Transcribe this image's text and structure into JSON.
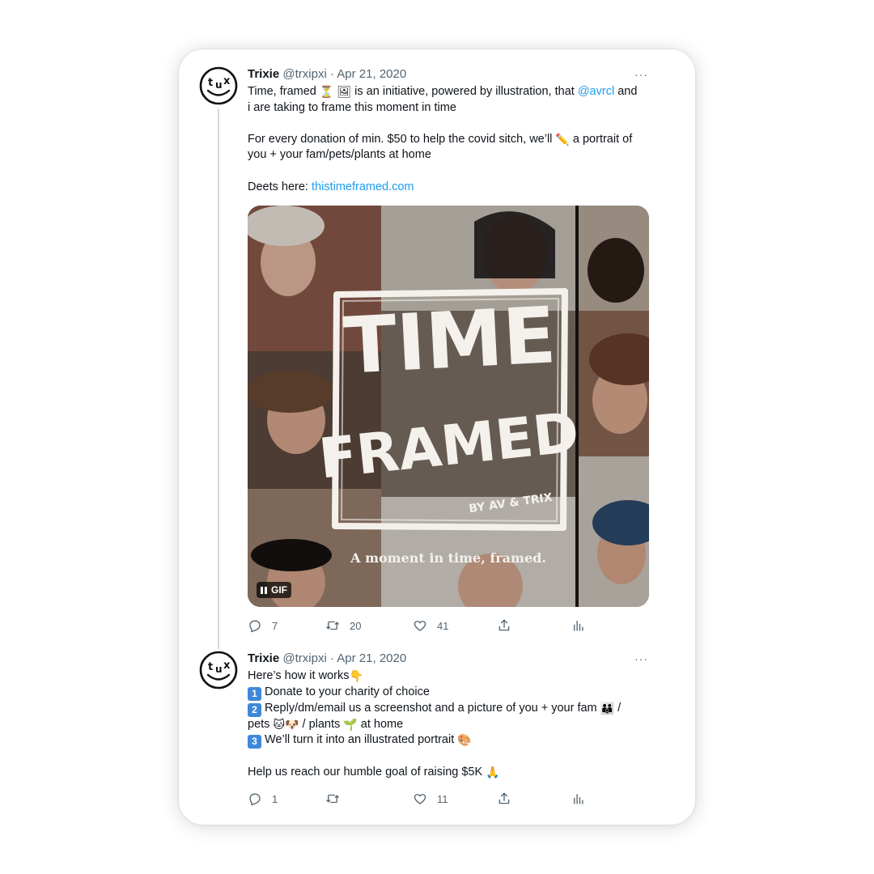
{
  "tweets": [
    {
      "name": "Trixie",
      "handle": "@trxipxi",
      "separator": "·",
      "date": "Apr 21, 2020",
      "more": "···",
      "line1_a": "Time, framed ",
      "line1_emoji1": "⏳",
      "line1_emoji2": "🖼",
      "line1_b": " is an initiative, powered by illustration, that ",
      "mention": "@avrcl",
      "line1_c": " and",
      "line2": "i are taking to frame this moment in time",
      "line3_a": "For every donation of min. $50 to help the covid sitch, we’ll ",
      "line3_emoji": "✏️",
      "line3_b": " a portrait of",
      "line4": "you + your fam/pets/plants at home",
      "line5_a": "Deets here: ",
      "link": "thistimeframed.com",
      "media": {
        "art_line1": "TIME",
        "art_line2": "FRAMED",
        "art_byline": "BY AV & TRIX",
        "caption": "A moment in time, framed.",
        "gif_label": "GIF"
      },
      "counts": {
        "reply": "7",
        "retweet": "20",
        "like": "41"
      }
    },
    {
      "name": "Trixie",
      "handle": "@trxipxi",
      "separator": "·",
      "date": "Apr 21, 2020",
      "more": "···",
      "intro": "Here’s how it works",
      "intro_emoji": "👇",
      "step1_key": "1",
      "step1": "Donate to your charity of choice",
      "step2_key": "2",
      "step2": "Reply/dm/email us a screenshot and a picture of you + your fam ",
      "step2_emoji": "👪",
      "step2_tail": " /",
      "step2_line2_a": "pets ",
      "step2_emoji_cat": "🐱",
      "step2_emoji_dog": "🐶",
      "step2_line2_b": " / plants ",
      "step2_emoji_plant": "🌱",
      "step2_line2_c": " at home",
      "step3_key": "3",
      "step3": "We’ll turn it into an illustrated portrait ",
      "step3_emoji": "🎨",
      "closing": "Help us reach our humble goal of raising $5K ",
      "closing_emoji": "🙏",
      "counts": {
        "reply": "1",
        "retweet": "",
        "like": "11"
      }
    }
  ],
  "colors": {
    "link": "#1d9bf0",
    "secondary": "#536471",
    "thread": "#cfd9de"
  }
}
